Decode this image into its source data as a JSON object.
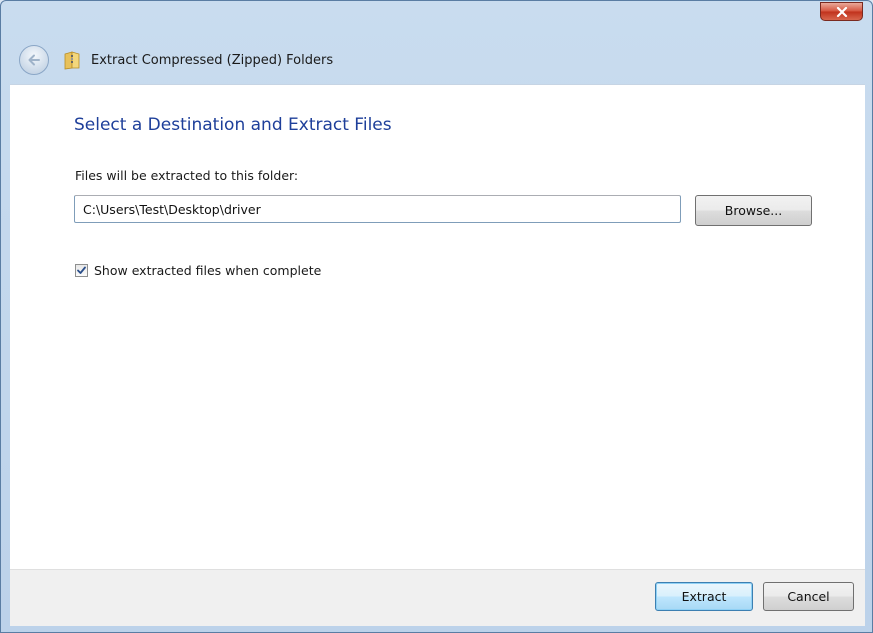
{
  "window": {
    "title": "Extract Compressed (Zipped) Folders"
  },
  "icons": {
    "close": "close-icon",
    "back": "back-arrow-icon",
    "folder": "zip-folder-icon",
    "checkmark": "checkmark-icon"
  },
  "main": {
    "heading": "Select a Destination and Extract Files",
    "field_label": "Files will be extracted to this folder:",
    "destination_value": "C:\\Users\\Test\\Desktop\\driver",
    "browse_label": "Browse...",
    "show_files_label": "Show extracted files when complete",
    "show_files_checked": true
  },
  "footer": {
    "extract_label": "Extract",
    "cancel_label": "Cancel"
  },
  "colors": {
    "heading": "#1e3f9a",
    "close_button": "#c0321c",
    "default_button_border": "#3c7fb1"
  }
}
